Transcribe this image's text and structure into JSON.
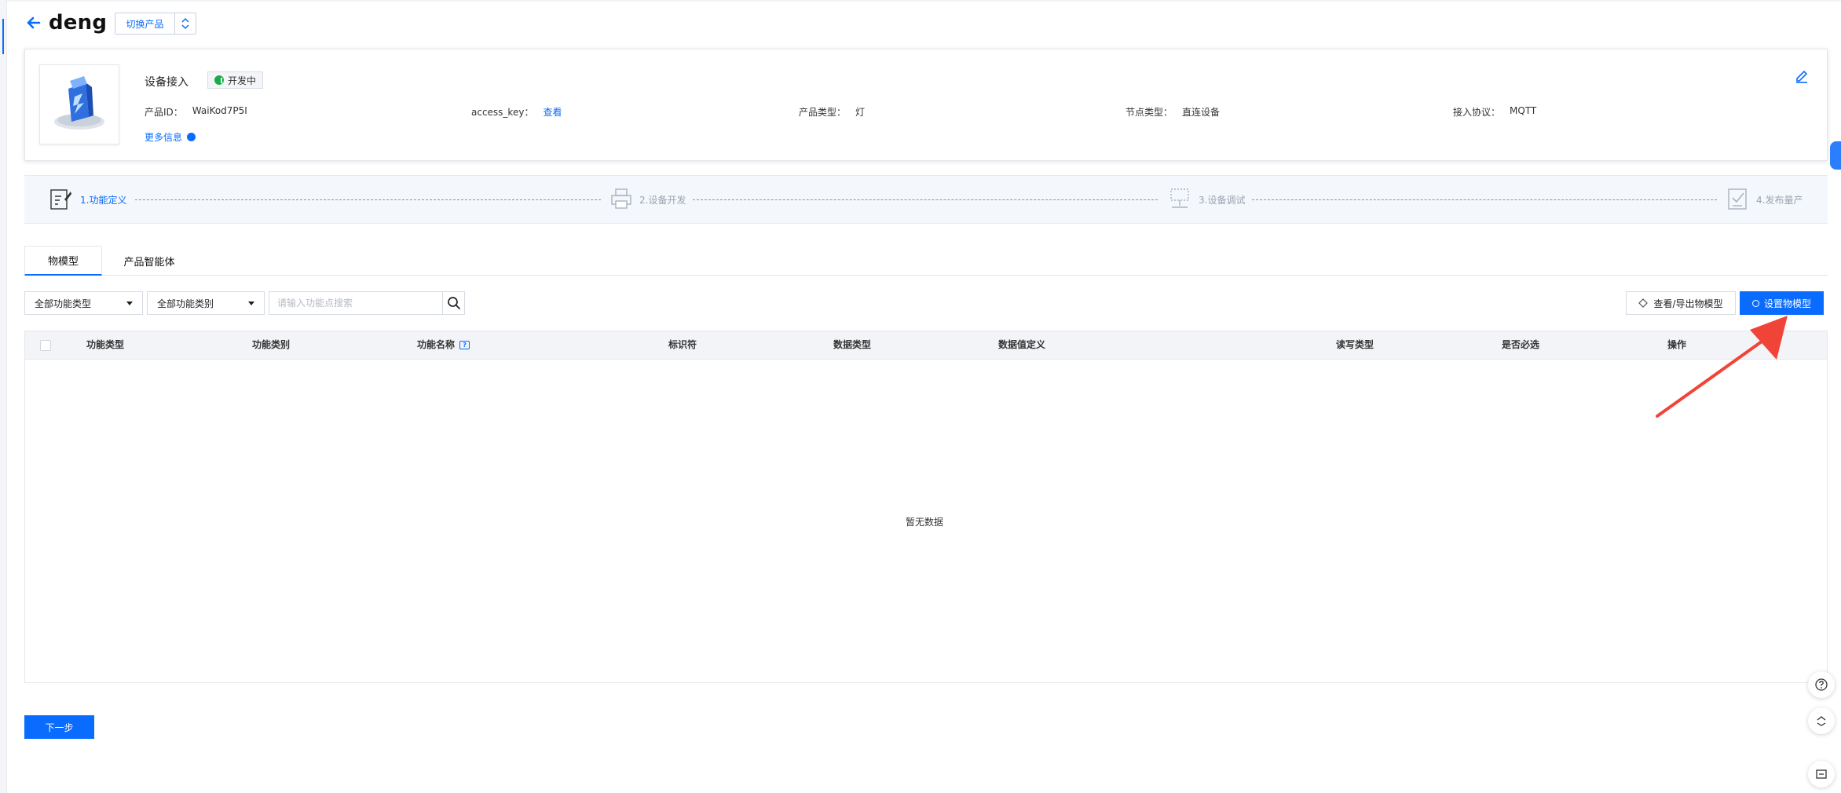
{
  "header": {
    "title": "deng",
    "switch_label": "切换产品"
  },
  "product": {
    "name": "设备接入",
    "status": "开发中",
    "fields": [
      {
        "key": "产品ID：",
        "value": "WaiKod7P5I"
      },
      {
        "key": "access_key：",
        "value": "查看"
      },
      {
        "key": "产品类型：",
        "value": "灯"
      },
      {
        "key": "节点类型：",
        "value": "直连设备"
      },
      {
        "key": "接入协议：",
        "value": "MQTT"
      }
    ],
    "more": "更多信息"
  },
  "steps": [
    {
      "label": "1.功能定义",
      "active": true
    },
    {
      "label": "2.设备开发",
      "active": false
    },
    {
      "label": "3.设备调试",
      "active": false
    },
    {
      "label": "4.发布量产",
      "active": false
    }
  ],
  "tabs": [
    {
      "label": "物模型",
      "active": true
    },
    {
      "label": "产品智能体",
      "active": false
    }
  ],
  "filters": {
    "type_select": "全部功能类型",
    "category_select": "全部功能类别",
    "search_placeholder": "请输入功能点搜索"
  },
  "actions": {
    "view_export": "查看/导出物模型",
    "set_model": "设置物模型"
  },
  "table": {
    "columns": [
      "功能类型",
      "功能类别",
      "功能名称",
      "标识符",
      "数据类型",
      "数据值定义",
      "读写类型",
      "是否必选",
      "操作"
    ],
    "name_help": "?",
    "empty": "暂无数据"
  },
  "footer": {
    "next": "下一步"
  },
  "colors": {
    "accent": "#0a6cff",
    "status_green": "#1aab4a",
    "annotation_arrow": "#f04438"
  }
}
